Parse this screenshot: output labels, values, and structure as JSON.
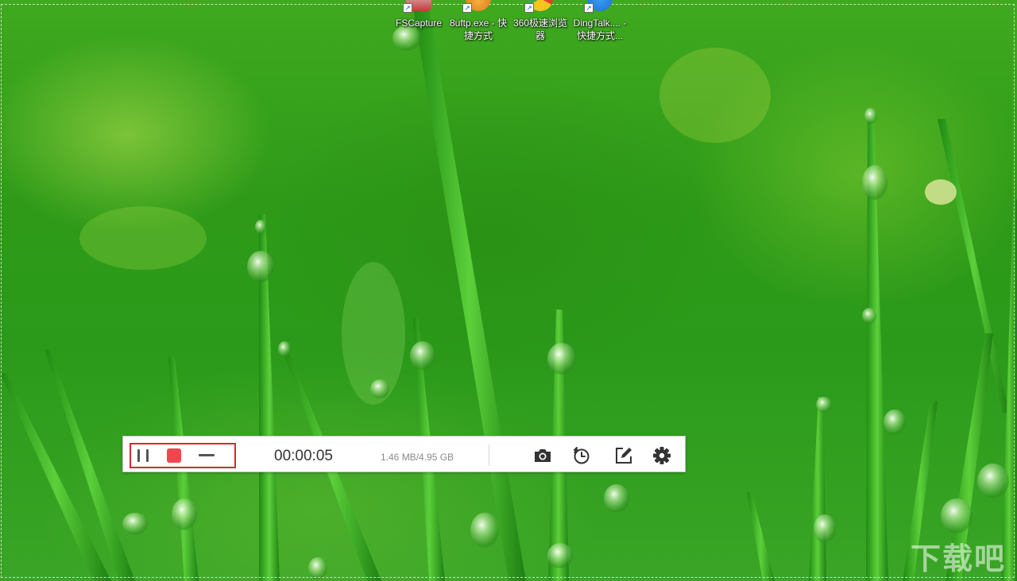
{
  "desktop": {
    "icons": [
      {
        "label": "FSCapture"
      },
      {
        "label": "8uftp.exe - 快捷方式"
      },
      {
        "label": "360极速浏览器"
      },
      {
        "label": "DingTalk.... - 快捷方式..."
      }
    ],
    "shortcut_arrow": "↗"
  },
  "recorder": {
    "timer": "00:00:05",
    "file_size": "1.46 MB/4.95 GB",
    "controls": {
      "pause_icon": "pause-icon",
      "stop_icon": "stop-icon",
      "minimize_icon": "minimize-icon"
    },
    "tools": {
      "camera_icon": "camera-icon",
      "schedule_icon": "alarm-clock-icon",
      "edit_icon": "edit-icon",
      "settings_icon": "gear-icon"
    },
    "colors": {
      "highlight": "#d9272e",
      "stop": "#f0474e",
      "icon": "#333333"
    }
  }
}
